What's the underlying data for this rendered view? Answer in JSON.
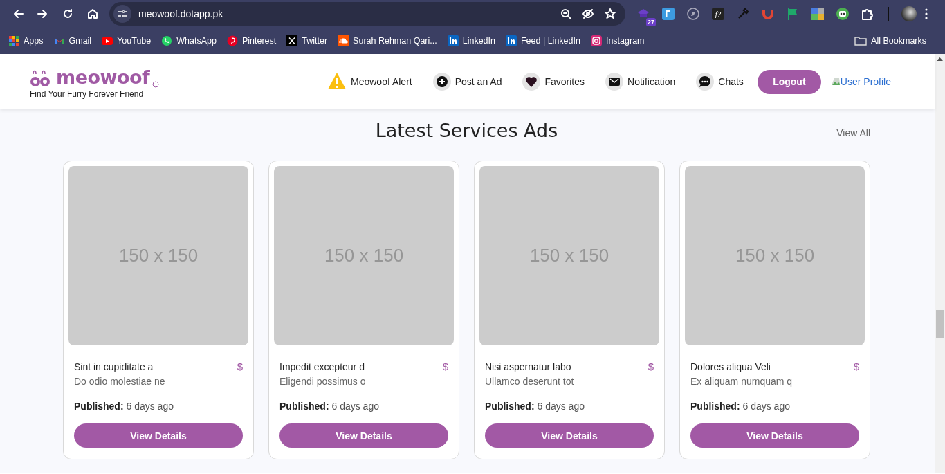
{
  "browser": {
    "url": "meowoof.dotapp.pk",
    "extensions": [
      {
        "kind": "badge",
        "badge": "27"
      },
      {
        "kind": "blue"
      },
      {
        "kind": "compass"
      },
      {
        "kind": "text",
        "glyph": "f?"
      },
      {
        "kind": "dropper"
      },
      {
        "kind": "magnet"
      },
      {
        "kind": "flag"
      },
      {
        "kind": "tile"
      },
      {
        "kind": "robot"
      },
      {
        "kind": "puzzle"
      }
    ],
    "bookmarks": [
      {
        "kind": "apps",
        "label": "Apps"
      },
      {
        "kind": "gmail",
        "label": "Gmail"
      },
      {
        "kind": "youtube",
        "label": "YouTube"
      },
      {
        "kind": "whatsapp",
        "label": "WhatsApp"
      },
      {
        "kind": "pinterest",
        "label": "Pinterest"
      },
      {
        "kind": "x",
        "label": "Twitter"
      },
      {
        "kind": "soundcloud",
        "label": "Surah Rehman Qari..."
      },
      {
        "kind": "linkedin",
        "label": "LinkedIn"
      },
      {
        "kind": "linkedin",
        "label": "Feed | LinkedIn"
      },
      {
        "kind": "instagram",
        "label": "Instagram"
      }
    ],
    "all_bookmarks": "All Bookmarks"
  },
  "header": {
    "logo": "meowoof",
    "tagline": "Find Your Furry Forever Friend",
    "nav": [
      {
        "kind": "alert",
        "label": "Meowoof Alert"
      },
      {
        "kind": "plus",
        "label": "Post an Ad"
      },
      {
        "kind": "heart",
        "label": "Favorites"
      },
      {
        "kind": "mail",
        "label": "Notification"
      },
      {
        "kind": "chat",
        "label": "Chats"
      }
    ],
    "logout": "Logout",
    "profile_link": "User Profile"
  },
  "section": {
    "title": "Latest Services Ads",
    "view_all": "View All",
    "cards": [
      {
        "image_label": "150 x 150",
        "title": "Sint in cupiditate a",
        "price": "$",
        "description": "Do odio molestiae ne",
        "published": "**Published:** 6 days ago",
        "button": "View Details"
      },
      {
        "image_label": "150 x 150",
        "title": "Impedit excepteur d",
        "price": "$",
        "description": "Eligendi possimus o",
        "published": "**Published:** 6 days ago",
        "button": "View Details"
      },
      {
        "image_label": "150 x 150",
        "title": "Nisi aspernatur labo",
        "price": "$",
        "description": "Ullamco deserunt tot",
        "published": "**Published:** 6 days ago",
        "button": "View Details"
      },
      {
        "image_label": "150 x 150",
        "title": "Dolores aliqua Veli",
        "price": "$",
        "description": "Ex aliquam numquam q",
        "published": "**Published:** 6 days ago",
        "button": "View Details"
      }
    ]
  }
}
